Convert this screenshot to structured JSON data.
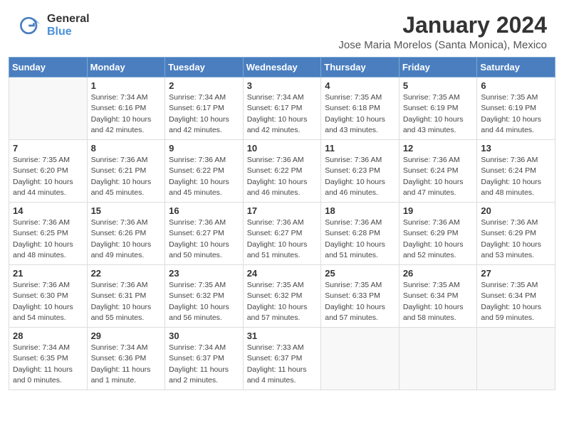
{
  "header": {
    "logo_general": "General",
    "logo_blue": "Blue",
    "month_year": "January 2024",
    "location": "Jose Maria Morelos (Santa Monica), Mexico"
  },
  "days_of_week": [
    "Sunday",
    "Monday",
    "Tuesday",
    "Wednesday",
    "Thursday",
    "Friday",
    "Saturday"
  ],
  "weeks": [
    [
      {
        "day": "",
        "info": ""
      },
      {
        "day": "1",
        "info": "Sunrise: 7:34 AM\nSunset: 6:16 PM\nDaylight: 10 hours\nand 42 minutes."
      },
      {
        "day": "2",
        "info": "Sunrise: 7:34 AM\nSunset: 6:17 PM\nDaylight: 10 hours\nand 42 minutes."
      },
      {
        "day": "3",
        "info": "Sunrise: 7:34 AM\nSunset: 6:17 PM\nDaylight: 10 hours\nand 42 minutes."
      },
      {
        "day": "4",
        "info": "Sunrise: 7:35 AM\nSunset: 6:18 PM\nDaylight: 10 hours\nand 43 minutes."
      },
      {
        "day": "5",
        "info": "Sunrise: 7:35 AM\nSunset: 6:19 PM\nDaylight: 10 hours\nand 43 minutes."
      },
      {
        "day": "6",
        "info": "Sunrise: 7:35 AM\nSunset: 6:19 PM\nDaylight: 10 hours\nand 44 minutes."
      }
    ],
    [
      {
        "day": "7",
        "info": "Sunrise: 7:35 AM\nSunset: 6:20 PM\nDaylight: 10 hours\nand 44 minutes."
      },
      {
        "day": "8",
        "info": "Sunrise: 7:36 AM\nSunset: 6:21 PM\nDaylight: 10 hours\nand 45 minutes."
      },
      {
        "day": "9",
        "info": "Sunrise: 7:36 AM\nSunset: 6:22 PM\nDaylight: 10 hours\nand 45 minutes."
      },
      {
        "day": "10",
        "info": "Sunrise: 7:36 AM\nSunset: 6:22 PM\nDaylight: 10 hours\nand 46 minutes."
      },
      {
        "day": "11",
        "info": "Sunrise: 7:36 AM\nSunset: 6:23 PM\nDaylight: 10 hours\nand 46 minutes."
      },
      {
        "day": "12",
        "info": "Sunrise: 7:36 AM\nSunset: 6:24 PM\nDaylight: 10 hours\nand 47 minutes."
      },
      {
        "day": "13",
        "info": "Sunrise: 7:36 AM\nSunset: 6:24 PM\nDaylight: 10 hours\nand 48 minutes."
      }
    ],
    [
      {
        "day": "14",
        "info": "Sunrise: 7:36 AM\nSunset: 6:25 PM\nDaylight: 10 hours\nand 48 minutes."
      },
      {
        "day": "15",
        "info": "Sunrise: 7:36 AM\nSunset: 6:26 PM\nDaylight: 10 hours\nand 49 minutes."
      },
      {
        "day": "16",
        "info": "Sunrise: 7:36 AM\nSunset: 6:27 PM\nDaylight: 10 hours\nand 50 minutes."
      },
      {
        "day": "17",
        "info": "Sunrise: 7:36 AM\nSunset: 6:27 PM\nDaylight: 10 hours\nand 51 minutes."
      },
      {
        "day": "18",
        "info": "Sunrise: 7:36 AM\nSunset: 6:28 PM\nDaylight: 10 hours\nand 51 minutes."
      },
      {
        "day": "19",
        "info": "Sunrise: 7:36 AM\nSunset: 6:29 PM\nDaylight: 10 hours\nand 52 minutes."
      },
      {
        "day": "20",
        "info": "Sunrise: 7:36 AM\nSunset: 6:29 PM\nDaylight: 10 hours\nand 53 minutes."
      }
    ],
    [
      {
        "day": "21",
        "info": "Sunrise: 7:36 AM\nSunset: 6:30 PM\nDaylight: 10 hours\nand 54 minutes."
      },
      {
        "day": "22",
        "info": "Sunrise: 7:36 AM\nSunset: 6:31 PM\nDaylight: 10 hours\nand 55 minutes."
      },
      {
        "day": "23",
        "info": "Sunrise: 7:35 AM\nSunset: 6:32 PM\nDaylight: 10 hours\nand 56 minutes."
      },
      {
        "day": "24",
        "info": "Sunrise: 7:35 AM\nSunset: 6:32 PM\nDaylight: 10 hours\nand 57 minutes."
      },
      {
        "day": "25",
        "info": "Sunrise: 7:35 AM\nSunset: 6:33 PM\nDaylight: 10 hours\nand 57 minutes."
      },
      {
        "day": "26",
        "info": "Sunrise: 7:35 AM\nSunset: 6:34 PM\nDaylight: 10 hours\nand 58 minutes."
      },
      {
        "day": "27",
        "info": "Sunrise: 7:35 AM\nSunset: 6:34 PM\nDaylight: 10 hours\nand 59 minutes."
      }
    ],
    [
      {
        "day": "28",
        "info": "Sunrise: 7:34 AM\nSunset: 6:35 PM\nDaylight: 11 hours\nand 0 minutes."
      },
      {
        "day": "29",
        "info": "Sunrise: 7:34 AM\nSunset: 6:36 PM\nDaylight: 11 hours\nand 1 minute."
      },
      {
        "day": "30",
        "info": "Sunrise: 7:34 AM\nSunset: 6:37 PM\nDaylight: 11 hours\nand 2 minutes."
      },
      {
        "day": "31",
        "info": "Sunrise: 7:33 AM\nSunset: 6:37 PM\nDaylight: 11 hours\nand 4 minutes."
      },
      {
        "day": "",
        "info": ""
      },
      {
        "day": "",
        "info": ""
      },
      {
        "day": "",
        "info": ""
      }
    ]
  ]
}
